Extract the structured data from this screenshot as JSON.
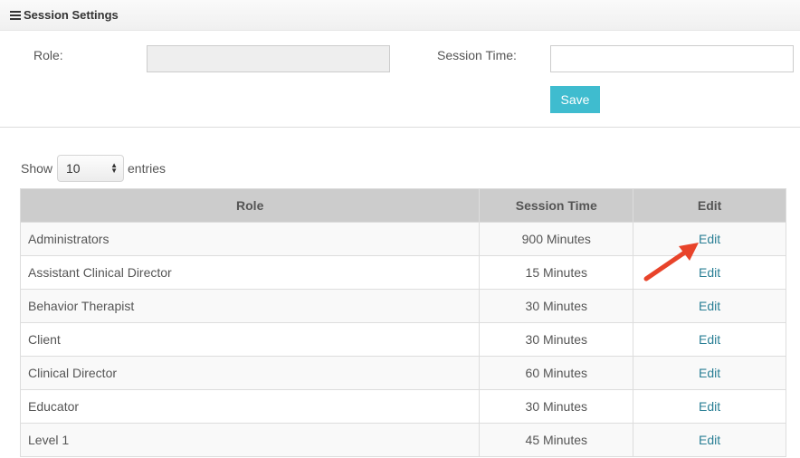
{
  "header": {
    "title": "Session Settings"
  },
  "form": {
    "role_label": "Role:",
    "role_value": "",
    "session_time_label": "Session Time:",
    "session_time_value": "",
    "save_label": "Save"
  },
  "length_control": {
    "show_label": "Show",
    "selected": "10",
    "entries_label": "entries"
  },
  "table": {
    "columns": [
      "Role",
      "Session Time",
      "Edit"
    ],
    "rows": [
      {
        "role": "Administrators",
        "time": "900 Minutes",
        "edit": "Edit"
      },
      {
        "role": "Assistant Clinical Director",
        "time": "15 Minutes",
        "edit": "Edit"
      },
      {
        "role": "Behavior Therapist",
        "time": "30 Minutes",
        "edit": "Edit"
      },
      {
        "role": "Client",
        "time": "30 Minutes",
        "edit": "Edit"
      },
      {
        "role": "Clinical Director",
        "time": "60 Minutes",
        "edit": "Edit"
      },
      {
        "role": "Educator",
        "time": "30 Minutes",
        "edit": "Edit"
      },
      {
        "role": "Level 1",
        "time": "45 Minutes",
        "edit": "Edit"
      }
    ]
  },
  "colors": {
    "accent": "#3fbccf",
    "link": "#2a7f95",
    "annotation_arrow": "#e8432a",
    "header_row": "#cccccc"
  },
  "icons": {
    "menu": "hamburger-icon",
    "select": "select-arrows-icon",
    "annotation": "red-arrow-annotation"
  }
}
